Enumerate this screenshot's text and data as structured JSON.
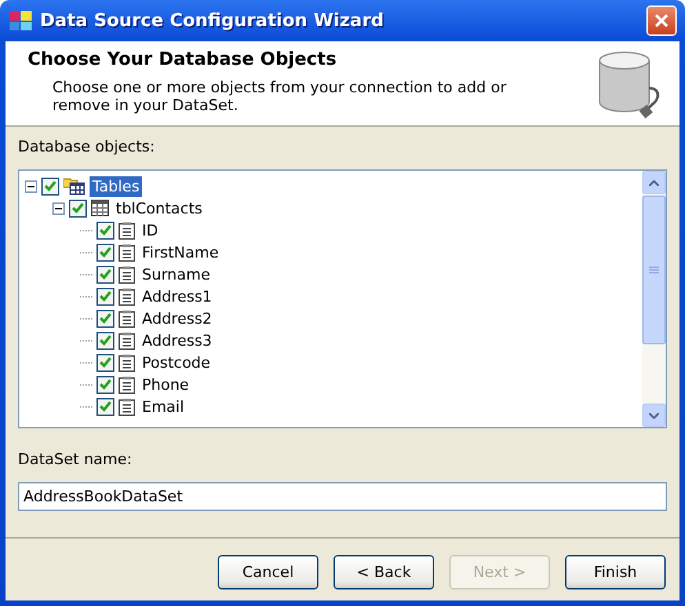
{
  "window": {
    "title": "Data Source Configuration Wizard"
  },
  "header": {
    "title": "Choose Your Database Objects",
    "description": "Choose one or more objects from your connection to add or remove in your DataSet."
  },
  "objects_label": "Database objects:",
  "tree": [
    {
      "label": "Tables",
      "kind": "folder",
      "checked": true,
      "expanded": true,
      "selected": true,
      "children": [
        {
          "label": "tblContacts",
          "kind": "table",
          "checked": true,
          "expanded": true,
          "selected": false,
          "children": [
            {
              "label": "ID",
              "kind": "column",
              "checked": true,
              "selected": false
            },
            {
              "label": "FirstName",
              "kind": "column",
              "checked": true,
              "selected": false
            },
            {
              "label": "Surname",
              "kind": "column",
              "checked": true,
              "selected": false
            },
            {
              "label": "Address1",
              "kind": "column",
              "checked": true,
              "selected": false
            },
            {
              "label": "Address2",
              "kind": "column",
              "checked": true,
              "selected": false
            },
            {
              "label": "Address3",
              "kind": "column",
              "checked": true,
              "selected": false
            },
            {
              "label": "Postcode",
              "kind": "column",
              "checked": true,
              "selected": false
            },
            {
              "label": "Phone",
              "kind": "column",
              "checked": true,
              "selected": false
            },
            {
              "label": "Email",
              "kind": "column",
              "checked": true,
              "selected": false
            }
          ]
        }
      ]
    }
  ],
  "dataset_label": "DataSet name:",
  "dataset_name": "AddressBookDataSet",
  "buttons": [
    {
      "label": "Cancel",
      "disabled": false
    },
    {
      "label": "< Back",
      "disabled": false
    },
    {
      "label": "Next >",
      "disabled": true
    },
    {
      "label": "Finish",
      "disabled": false
    }
  ]
}
